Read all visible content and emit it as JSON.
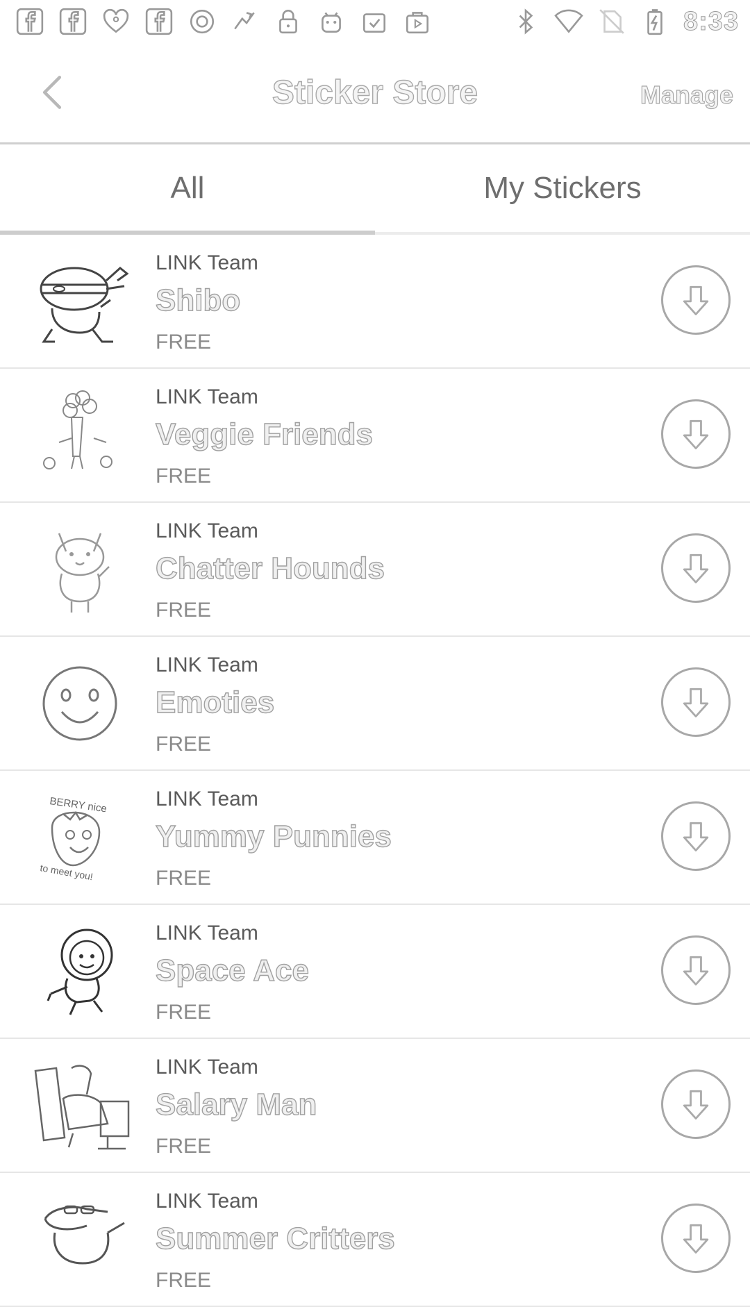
{
  "status_bar": {
    "time": "8:33",
    "icons": [
      "facebook-icon",
      "facebook-icon",
      "iheartradio-icon",
      "facebook-icon",
      "circle-app-icon",
      "game-icon",
      "lock-icon",
      "android-icon",
      "clipboard-check-icon",
      "play-bag-icon",
      "bluetooth-icon",
      "wifi-icon",
      "no-sim-icon",
      "battery-charging-icon"
    ]
  },
  "header": {
    "title": "Sticker Store",
    "manage_label": "Manage",
    "back_icon": "chevron-left-icon"
  },
  "tabs": [
    {
      "label": "All",
      "active": true
    },
    {
      "label": "My Stickers",
      "active": false
    }
  ],
  "stickers": [
    {
      "publisher": "LINK Team",
      "name": "Shibo",
      "price": "FREE",
      "thumb": "ninja-character-sticker"
    },
    {
      "publisher": "LINK Team",
      "name": "Veggie Friends",
      "price": "FREE",
      "thumb": "carrot-broccoli-sticker"
    },
    {
      "publisher": "LINK Team",
      "name": "Chatter Hounds",
      "price": "FREE",
      "thumb": "dog-sticker"
    },
    {
      "publisher": "LINK Team",
      "name": "Emoties",
      "price": "FREE",
      "thumb": "smiley-face-sticker"
    },
    {
      "publisher": "LINK Team",
      "name": "Yummy Punnies",
      "price": "FREE",
      "thumb": "strawberry-sticker",
      "thumb_text_top": "BERRY nice",
      "thumb_text_bottom": "to meet you!"
    },
    {
      "publisher": "LINK Team",
      "name": "Space Ace",
      "price": "FREE",
      "thumb": "astronaut-sticker"
    },
    {
      "publisher": "LINK Team",
      "name": "Salary Man",
      "price": "FREE",
      "thumb": "office-worker-sticker"
    },
    {
      "publisher": "LINK Team",
      "name": "Summer Critters",
      "price": "FREE",
      "thumb": "crocodile-sticker"
    }
  ],
  "colors": {
    "background": "#ffffff",
    "divider": "#e6e6e6",
    "outline_text": "#a0a0a0"
  }
}
